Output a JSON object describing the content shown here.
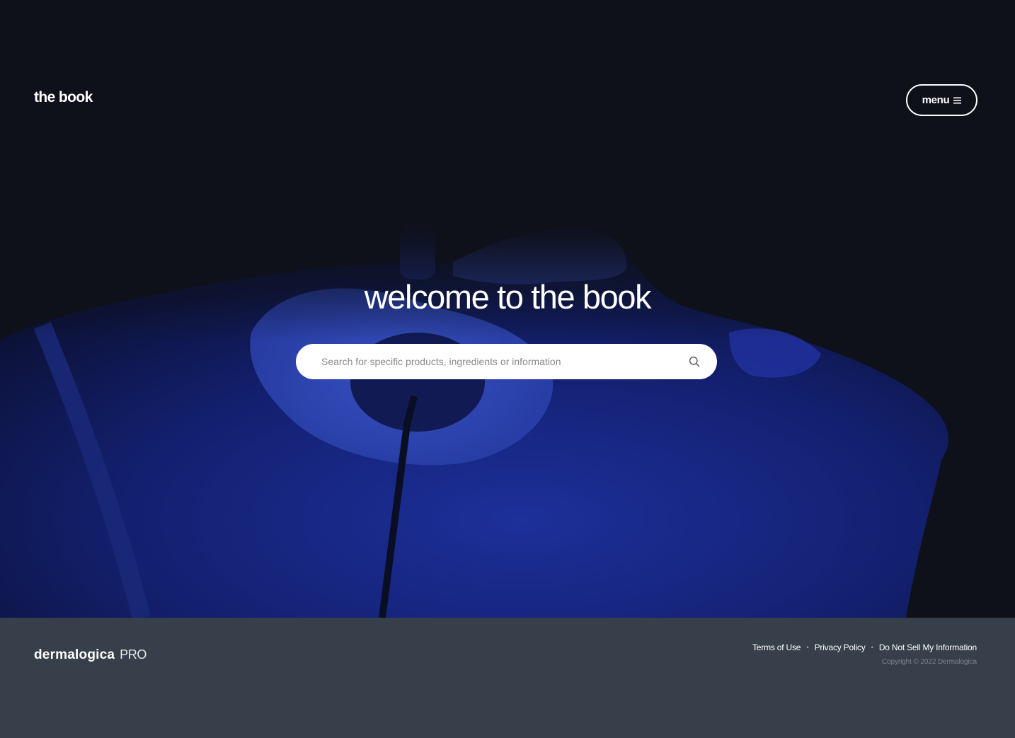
{
  "header": {
    "brand": "the book",
    "menu_label": "menu",
    "menu_icon": "hamburger-icon"
  },
  "hero": {
    "title": "welcome to the book",
    "search": {
      "placeholder": "Search for specific products, ingredients or information",
      "value": "",
      "icon": "search-icon"
    },
    "background_image": "face-treatment-photo-blue-tint"
  },
  "footer": {
    "logo_word": "dermalogica",
    "logo_suffix": "PRO",
    "links": [
      {
        "label": "Terms of Use"
      },
      {
        "label": "Privacy Policy"
      },
      {
        "label": "Do Not Sell My Information"
      }
    ],
    "separator": "•",
    "copyright": "Copyright © 2022 Dermalogica"
  },
  "colors": {
    "hero_background": "#0e101a",
    "image_tint": "#1e3ab0",
    "footer_background": "#37404a",
    "text_primary": "#ffffff",
    "copyright_text": "#7c858f"
  }
}
